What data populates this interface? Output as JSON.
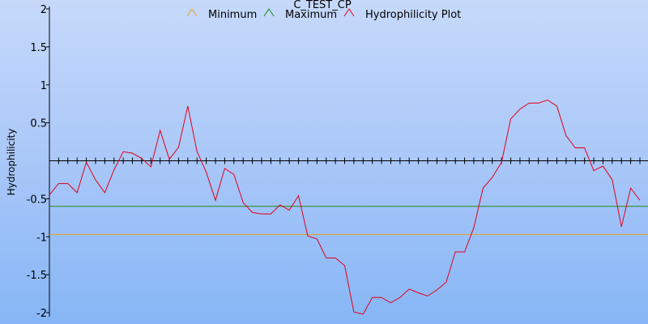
{
  "chart_data": {
    "type": "line",
    "title": "C_TEST_CP",
    "ylabel": "Hydrophilicity",
    "xlabel": "",
    "ylim": [
      -2,
      2
    ],
    "yticks": [
      {
        "value": 2,
        "label": "2"
      },
      {
        "value": 1.5,
        "label": "1.5"
      },
      {
        "value": 1,
        "label": "1"
      },
      {
        "value": 0.5,
        "label": "0.5"
      },
      {
        "value": -0.5,
        "label": "-0.5"
      },
      {
        "value": -1,
        "label": "-1"
      },
      {
        "value": -1.5,
        "label": "-1.5"
      },
      {
        "value": -2,
        "label": "-2"
      }
    ],
    "zero_line": 0,
    "legend_position": "top",
    "series": [
      {
        "name": "Minimum",
        "color": "#e8a020",
        "kind": "hline",
        "value": -0.97
      },
      {
        "name": "Maximum",
        "color": "#1f8a1f",
        "kind": "hline",
        "value": -0.6
      },
      {
        "name": "Hydrophilicity Plot",
        "color": "#e0001a",
        "kind": "line",
        "values": [
          -0.45,
          -0.3,
          -0.3,
          -0.42,
          -0.02,
          -0.25,
          -0.42,
          -0.12,
          0.12,
          0.1,
          0.03,
          -0.08,
          0.4,
          0.02,
          0.18,
          0.72,
          0.12,
          -0.15,
          -0.52,
          -0.1,
          -0.18,
          -0.55,
          -0.68,
          -0.7,
          -0.7,
          -0.58,
          -0.65,
          -0.46,
          -0.99,
          -1.03,
          -1.28,
          -1.28,
          -1.38,
          -1.99,
          -2.02,
          -1.8,
          -1.8,
          -1.87,
          -1.8,
          -1.69,
          -1.74,
          -1.78,
          -1.7,
          -1.6,
          -1.2,
          -1.2,
          -0.88,
          -0.36,
          -0.22,
          -0.02,
          0.55,
          0.68,
          0.76,
          0.76,
          0.8,
          0.72,
          0.33,
          0.17,
          0.17,
          -0.13,
          -0.07,
          -0.25,
          -0.87,
          -0.36,
          -0.52
        ]
      }
    ]
  }
}
